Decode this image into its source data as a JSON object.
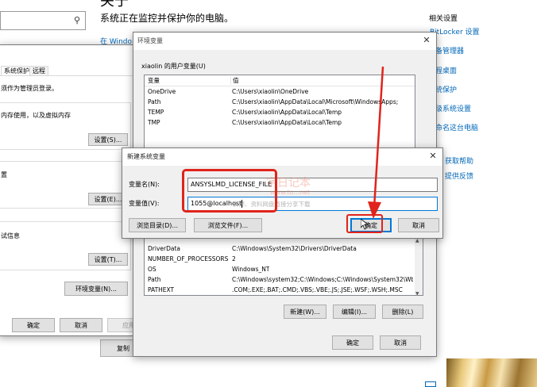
{
  "settings": {
    "title": "关于",
    "monitor_text": "系统正在监控并保护你的电脑。",
    "windows_link": "在 Windo",
    "related_title": "相关设置",
    "related_links": [
      "BitLocker 设置",
      "备管理器",
      "程桌面",
      "统保护",
      "级系统设置",
      "命名这台电脑"
    ],
    "help_links": [
      "获取帮助",
      "提供反馈"
    ],
    "copy_button": "复制"
  },
  "sysprops": {
    "tabs": [
      "系统保护",
      "远程"
    ],
    "admin_note": "须作为管理员登录。",
    "perf_note": "内存使用，以及虚拟内存",
    "profile_label": "置",
    "startup_label": "试信息",
    "settings_s": "设置(S)...",
    "settings_e": "设置(E)...",
    "settings_t": "设置(T)...",
    "env_button": "环境变量(N)...",
    "ok": "确定",
    "cancel": "取消",
    "apply": "应用"
  },
  "envvars": {
    "title": "环境变量",
    "user_group": "xiaolin 的用户变量(U)",
    "columns": [
      "变量",
      "值"
    ],
    "user_vars": [
      {
        "name": "OneDrive",
        "value": "C:\\Users\\xiaolin\\OneDrive"
      },
      {
        "name": "Path",
        "value": "C:\\Users\\xiaolin\\AppData\\Local\\Microsoft\\WindowsApps;"
      },
      {
        "name": "TEMP",
        "value": "C:\\Users\\xiaolin\\AppData\\Local\\Temp"
      },
      {
        "name": "TMP",
        "value": "C:\\Users\\xiaolin\\AppData\\Local\\Temp"
      }
    ],
    "sys_vars": [
      {
        "name": "DriverData",
        "value": "C:\\Windows\\System32\\Drivers\\DriverData"
      },
      {
        "name": "NUMBER_OF_PROCESSORS",
        "value": "2"
      },
      {
        "name": "OS",
        "value": "Windows_NT"
      },
      {
        "name": "Path",
        "value": "C:\\Windows\\system32;C:\\Windows;C:\\Windows\\System32\\Wb..."
      },
      {
        "name": "PATHEXT",
        "value": ".COM;.EXE;.BAT;.CMD;.VBS;.VBE;.JS;.JSE;.WSF;.WSH;.MSC"
      }
    ],
    "new_button": "新建(W)...",
    "edit_button": "编辑(I)...",
    "delete_button": "删除(L)",
    "ok": "确定",
    "cancel": "取消"
  },
  "newvar": {
    "title": "新建系统变量",
    "name_label": "变量名(N):",
    "value_label": "变量值(V):",
    "name_value": "ANSYSLMD_LICENSE_FILE",
    "value_value": "1055@localhost",
    "browse_dir": "浏览目录(D)...",
    "browse_file": "浏览文件(F)...",
    "ok": "确定",
    "cancel": "取消"
  },
  "watermark": {
    "name": "字日记本",
    "url": "www.to...net",
    "slogan": "资源、资料网盘直接分享下载"
  },
  "colors": {
    "accent": "#0078d7",
    "highlight_red": "#e0241b",
    "link": "#0067b8"
  }
}
